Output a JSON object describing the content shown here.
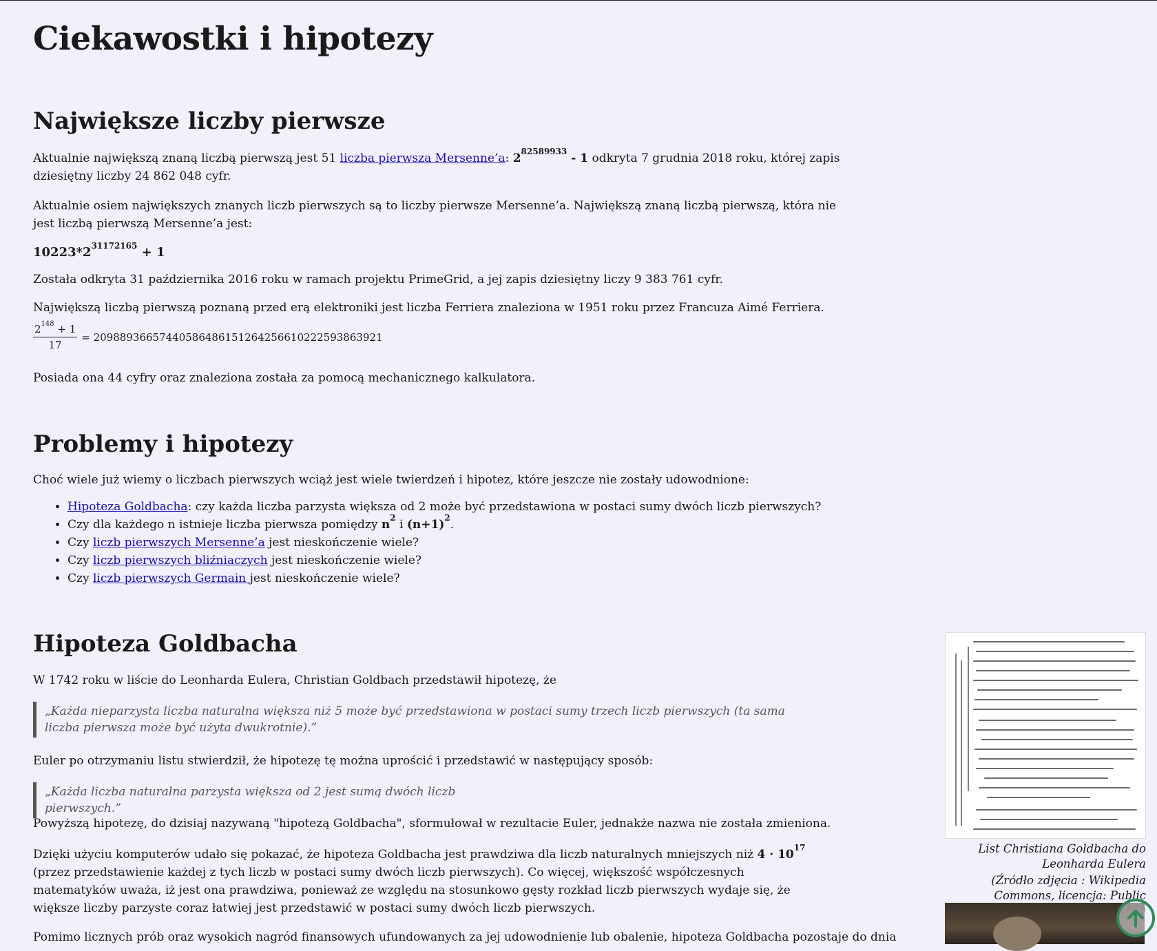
{
  "page": {
    "title": "Ciekawostki i hipotezy"
  },
  "largest": {
    "heading": "Największe liczby pierwsze",
    "p1_a": "Aktualnie największą znaną liczbą pierwszą jest 51 ",
    "p1_link": "liczba pierwsza Mersenne’a",
    "p1_b": ": ",
    "p1_base": "2",
    "p1_exp": "82589933",
    "p1_minus": " - 1",
    "p1_c": " odkryta 7 grudnia 2018 roku, której zapis dziesiętny liczby 24 862 048 cyfr.",
    "p2": "Aktualnie osiem największych znanych liczb pierwszych są to liczby pierwsze Mersenne’a. Największą znaną liczbą pierwszą, która nie jest liczbą pierwszą Mersenne’a jest:",
    "num_base": "10223*2",
    "num_exp": "31172165",
    "num_plus": " + 1",
    "p3": "Została odkryta 31 października 2016 roku w ramach projektu PrimeGrid, a jej zapis dziesiętny liczy 9 383 761 cyfr.",
    "p4": "Największą liczbą pierwszą poznaną przed erą elektroniki jest liczba Ferriera znaleziona w 1951 roku przez Francuza Aimé Ferriera.",
    "formula_num_base": "2",
    "formula_num_exp": "148",
    "formula_num_plus": " + 1",
    "formula_den": "17",
    "formula_result": "= 20988936657440586486151264256610222593863921",
    "p5": "Posiada ona 44 cyfry oraz znaleziona została za pomocą mechanicznego kalkulatora."
  },
  "problems": {
    "heading": "Problemy i hipotezy",
    "intro": "Choć wiele już wiemy o liczbach pierwszych wciąż jest wiele twierdzeń i hipotez, które jeszcze nie zostały udowodnione:",
    "item1_link": "Hipoteza Goldbacha",
    "item1_text": ": czy każda liczba parzysta większa od 2 może być przedstawiona w postaci sumy dwóch liczb pierwszych?",
    "item2_a": "Czy dla każdego n istnieje liczba pierwsza pomiędzy ",
    "item2_n": "n",
    "item2_exp1": "2",
    "item2_mid": " i ",
    "item2_n1": "(n+1)",
    "item2_exp2": "2",
    "item2_end": ".",
    "item3_a": "Czy ",
    "item3_link": "liczb pierwszych Mersenne’a",
    "item3_b": " jest nieskończenie wiele?",
    "item4_a": "Czy ",
    "item4_link": "liczb pierwszych bliźniaczych",
    "item4_b": " jest nieskończenie wiele?",
    "item5_a": "Czy ",
    "item5_link": "liczb pierwszych Germain ",
    "item5_b": "jest nieskończenie wiele?"
  },
  "goldbach": {
    "heading": "Hipoteza Goldbacha",
    "p1": "W 1742 roku w liście do Leonharda Eulera, Christian Goldbach przedstawił hipotezę, że",
    "quote1": "„Każda nieparzysta liczba naturalna większa niż 5 może być przedstawiona w postaci sumy trzech liczb pierwszych (ta sama liczba pierwsza może być użyta dwukrotnie).”",
    "p2": "Euler po otrzymaniu listu stwierdził, że hipotezę tę można uprościć i przedstawić w następujący sposób:",
    "quote2": "„Każda liczba naturalna parzysta większa od 2 jest sumą dwóch liczb pierwszych.”",
    "p3": "Powyższą hipotezę, do dzisiaj nazywaną \"hipotezą Goldbacha\", sformułował w rezultacie Euler, jednakże nazwa nie została zmieniona.",
    "p4_a": "Dzięki użyciu komputerów udało się pokazać, że hipoteza Goldbacha jest prawdziwa dla liczb naturalnych mniejszych niż ",
    "p4_bold": "4 · 10",
    "p4_exp": "17",
    "p4_b": " (przez przedstawienie każdej z tych liczb w postaci sumy dwóch liczb pierwszych). Co więcej, większość współczesnych matematyków uważa, iż jest ona prawdziwa, ponieważ ze względu na stosunkowo gęsty rozkład liczb pierwszych wydaje się, że większe liczby parzyste coraz łatwiej jest przedstawić w postaci sumy dwóch liczb pierwszych.",
    "p5": "Pomimo licznych prób oraz wysokich nagród finansowych ufundowanych za jej udowodnienie lub obalenie, hipoteza Goldbacha pozostaje do dnia",
    "caption1": "List Christiana Goldbacha do Leonharda Eulera",
    "caption2": "(Źródło zdjęcia : Wikipedia Commons, licencja: Public Domain)"
  }
}
